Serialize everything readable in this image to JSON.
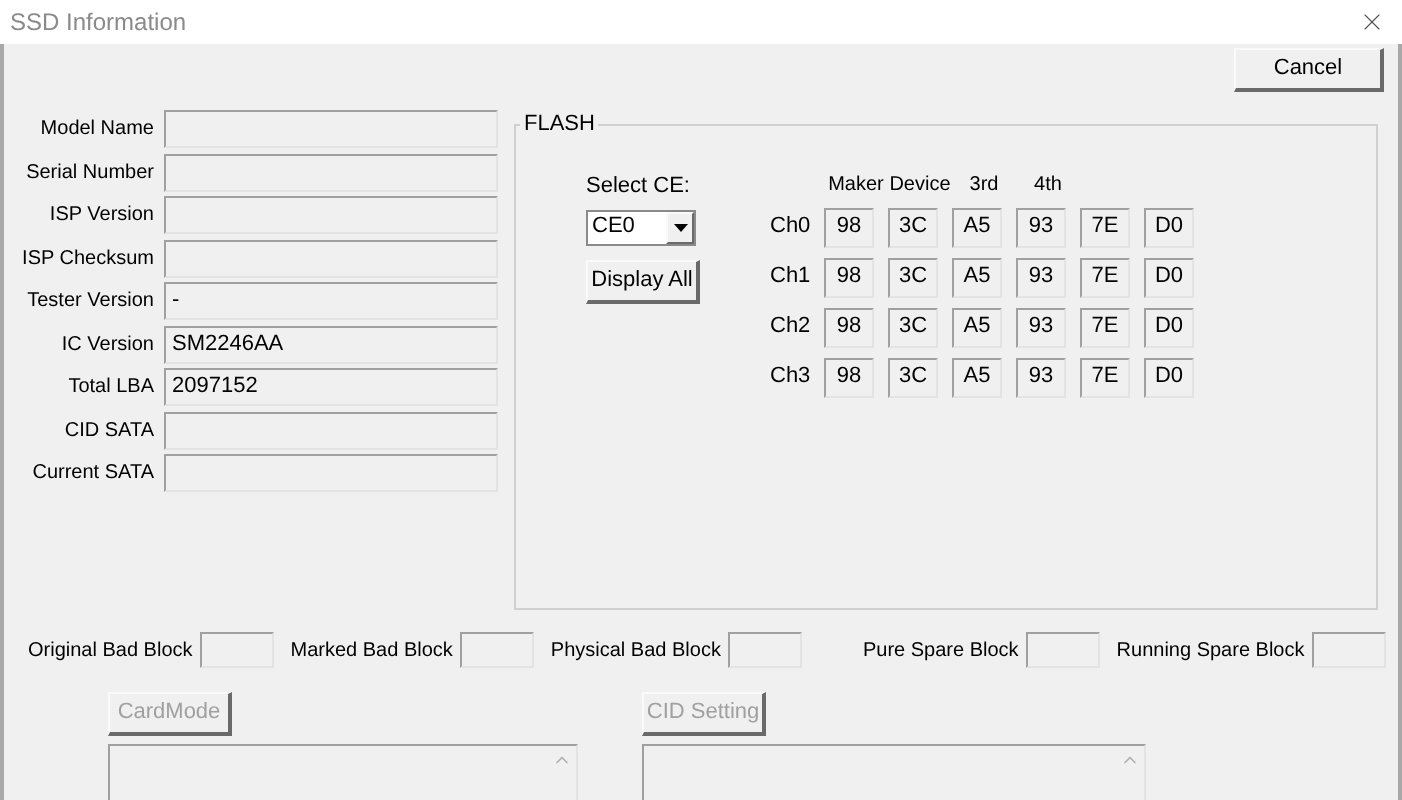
{
  "window": {
    "title": "SSD Information"
  },
  "cancel_button": "Cancel",
  "fields": [
    {
      "label": "Model Name"
    },
    {
      "label": "Serial Number"
    },
    {
      "label": "ISP Version"
    },
    {
      "label": "ISP Checksum"
    },
    {
      "label": "Tester Version",
      "value": "-"
    },
    {
      "label": "IC Version",
      "value": "SM2246AA"
    },
    {
      "label": "Total LBA",
      "value": "2097152"
    },
    {
      "label": "CID SATA"
    },
    {
      "label": "Current SATA"
    }
  ],
  "flash": {
    "title": "FLASH",
    "select_label": "Select CE:",
    "select_value": "CE0",
    "display_button": "Display All",
    "columns": [
      "Maker",
      "Device",
      "3rd",
      "4th"
    ],
    "rows": [
      {
        "label": "Ch0",
        "values": [
          "98",
          "3C",
          "A5",
          "93",
          "7E",
          "D0"
        ]
      },
      {
        "label": "Ch1",
        "values": [
          "98",
          "3C",
          "A5",
          "93",
          "7E",
          "D0"
        ]
      },
      {
        "label": "Ch2",
        "values": [
          "98",
          "3C",
          "A5",
          "93",
          "7E",
          "D0"
        ]
      },
      {
        "label": "Ch3",
        "values": [
          "98",
          "3C",
          "A5",
          "93",
          "7E",
          "D0"
        ]
      }
    ]
  },
  "block_counts": [
    {
      "label": "Original Bad Block"
    },
    {
      "label": "Marked Bad Block"
    },
    {
      "label": "Physical Bad Block"
    },
    {
      "label": "Pure Spare Block"
    },
    {
      "label": "Running Spare Block"
    }
  ],
  "bottom_buttons": [
    {
      "label": "CardMode",
      "disabled": true
    },
    {
      "label": "CID Setting",
      "disabled": true
    }
  ]
}
